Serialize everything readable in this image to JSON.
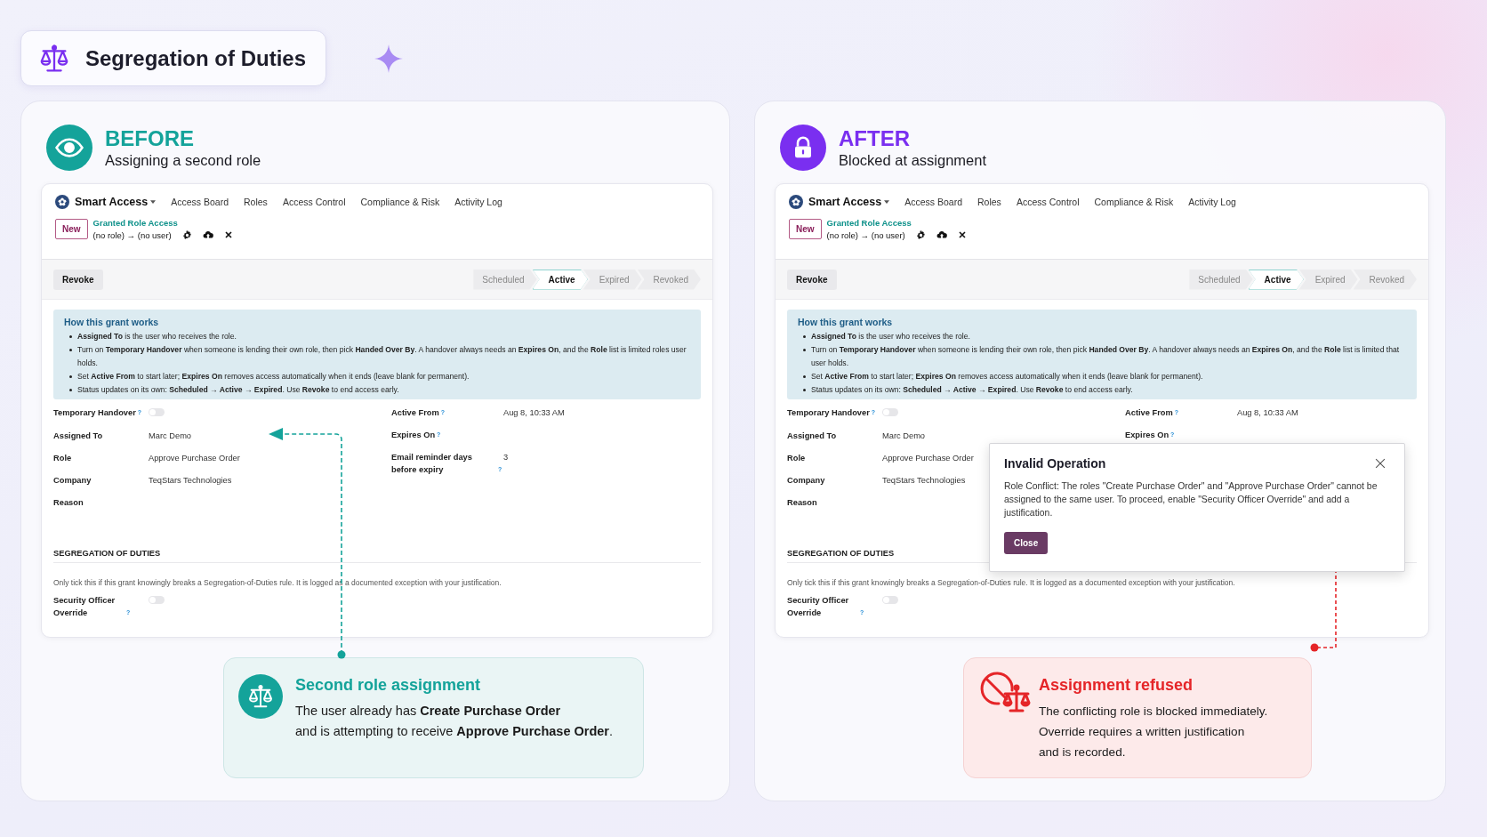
{
  "header": {
    "title": "Segregation of Duties"
  },
  "panels": [
    {
      "kind": "before",
      "label": "BEFORE",
      "subtitle": "Assigning a second role",
      "app": {
        "brand": "Smart Access",
        "menu": [
          "Access Board",
          "Roles",
          "Access Control",
          "Compliance & Risk",
          "Activity Log"
        ],
        "badge": "New",
        "breadcrumb": "Granted Role Access",
        "record": "(no role) → (no user)",
        "action": "Revoke",
        "stages": [
          {
            "label": "Scheduled",
            "selected": false
          },
          {
            "label": "Active",
            "selected": true
          },
          {
            "label": "Expired",
            "selected": false
          },
          {
            "label": "Revoked",
            "selected": false
          }
        ],
        "info": {
          "title": "How this grant works",
          "bullets": [
            "**Assigned To** is the user who receives the role.",
            "Turn on **Temporary Handover** when someone is lending their own role, then pick **Handed Over By**. A handover always needs an **Expires On**, and the **Role** list is limited roles user holds.",
            "Set **Active From** to start later; **Expires On** removes access automatically when it ends (leave blank for permanent).",
            "Status updates on its own: **Scheduled → Active → Expired**. Use **Revoke** to end access early."
          ]
        },
        "fields_left": [
          {
            "kind": "toggle",
            "label": "Temporary Handover",
            "help": "?",
            "on": false
          },
          {
            "kind": "text",
            "label": "Assigned To",
            "value": "Marc Demo"
          },
          {
            "kind": "text",
            "label": "Role",
            "value": "Approve Purchase Order"
          },
          {
            "kind": "text",
            "label": "Company",
            "value": "TeqStars Technologies"
          },
          {
            "kind": "text",
            "label": "Reason"
          }
        ],
        "fields_right": [
          {
            "kind": "text",
            "label": "Active From",
            "help": "?",
            "value": "Aug 8, 10:33 AM"
          },
          {
            "kind": "text",
            "label": "Expires On",
            "help": "?"
          },
          {
            "kind": "text",
            "label": "Email reminder days before expiry",
            "help": "?",
            "value": "3"
          }
        ],
        "section": "SEGREGATION OF DUTIES",
        "note": "Only tick this if this grant knowingly breaks a Segregation-of-Duties rule. It is logged as a documented exception with your justification.",
        "override": {
          "label": "Security Officer Override",
          "help": "?",
          "on": false
        }
      },
      "callout": {
        "title": "Second role assignment",
        "text": "The user already has **Create Purchase Order**\nand is attempting to receive **Approve Purchase Order**."
      }
    },
    {
      "kind": "after",
      "label": "AFTER",
      "subtitle": "Blocked at assignment",
      "app": {
        "brand": "Smart Access",
        "menu": [
          "Access Board",
          "Roles",
          "Access Control",
          "Compliance & Risk",
          "Activity Log"
        ],
        "badge": "New",
        "breadcrumb": "Granted Role Access",
        "record": "(no role) → (no user)",
        "action": "Revoke",
        "stages": [
          {
            "label": "Scheduled",
            "selected": false
          },
          {
            "label": "Active",
            "selected": true
          },
          {
            "label": "Expired",
            "selected": false
          },
          {
            "label": "Revoked",
            "selected": false
          }
        ],
        "info": {
          "title": "How this grant works",
          "bullets": [
            "**Assigned To** is the user who receives the role.",
            "Turn on **Temporary Handover** when someone is lending their own role, then pick **Handed Over By**. A handover always needs an **Expires On**, and the **Role** list is limited that user holds.",
            "Set **Active From** to start later; **Expires On** removes access automatically when it ends (leave blank for permanent).",
            "Status updates on its own: **Scheduled → Active → Expired**. Use **Revoke** to end access early."
          ]
        },
        "fields_left": [
          {
            "kind": "toggle",
            "label": "Temporary Handover",
            "help": "?",
            "on": false
          },
          {
            "kind": "text",
            "label": "Assigned To",
            "value": "Marc Demo"
          },
          {
            "kind": "text",
            "label": "Role",
            "value": "Approve Purchase Order"
          },
          {
            "kind": "text",
            "label": "Company",
            "value": "TeqStars Technologies"
          },
          {
            "kind": "text",
            "label": "Reason"
          }
        ],
        "fields_right": [
          {
            "kind": "text",
            "label": "Active From",
            "help": "?",
            "value": "Aug 8, 10:33 AM"
          },
          {
            "kind": "text",
            "label": "Expires On",
            "help": "?"
          }
        ],
        "section": "SEGREGATION OF DUTIES",
        "note": "Only tick this if this grant knowingly breaks a Segregation-of-Duties rule. It is logged as a documented exception with your justification.",
        "override": {
          "label": "Security Officer Override",
          "help": "?",
          "on": false
        }
      },
      "dialog": {
        "title": "Invalid Operation",
        "message": "Role Conflict: The roles \"Create Purchase Order\" and \"Approve Purchase Order\" cannot be assigned to the same user. To proceed, enable \"Security Officer Override\" and add a justification.",
        "button": "Close"
      },
      "callout": {
        "title": "Assignment refused",
        "text": "The conflicting role is blocked immediately.\nOverride requires a written justification\nand is recorded."
      }
    }
  ]
}
